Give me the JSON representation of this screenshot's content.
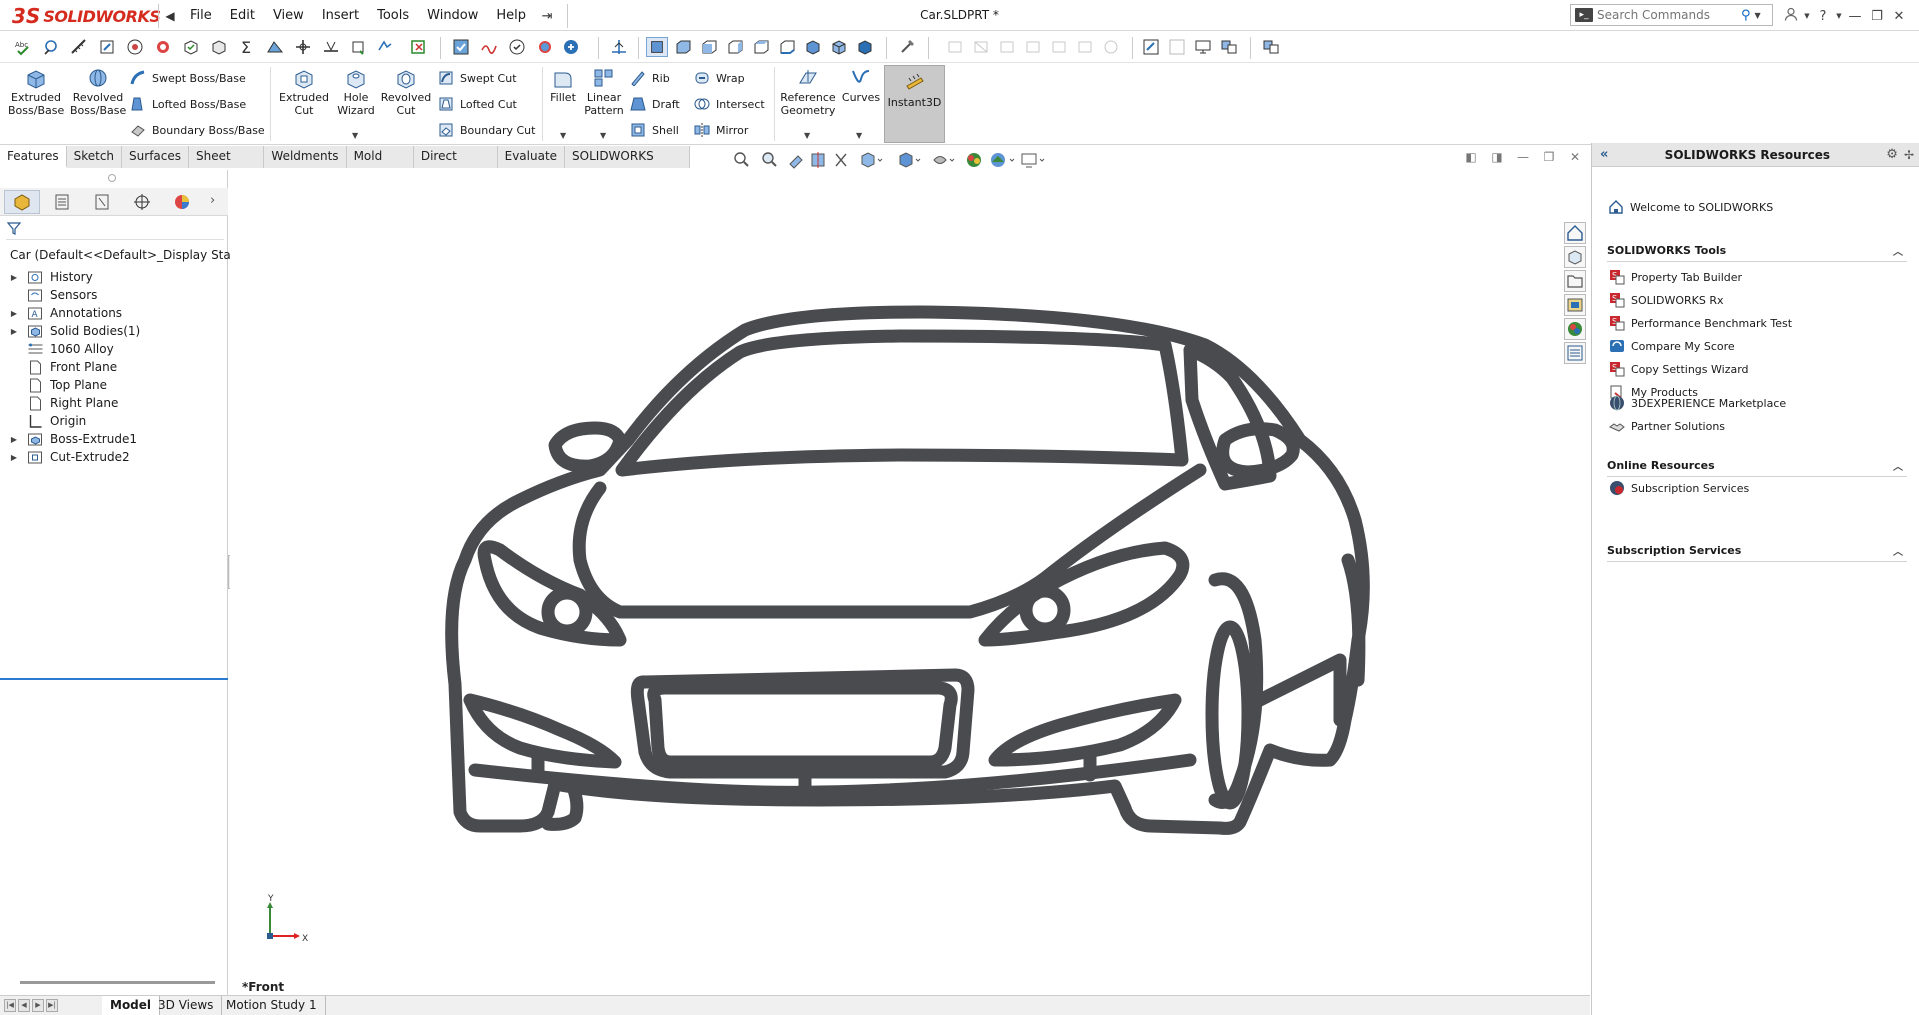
{
  "app": {
    "logo_ds": "3S",
    "logo_text": "SOLIDWORKS",
    "document_title": "Car.SLDPRT *"
  },
  "menu": [
    "File",
    "Edit",
    "View",
    "Insert",
    "Tools",
    "Window",
    "Help"
  ],
  "search": {
    "placeholder": "Search Commands"
  },
  "ribbon": {
    "extruded_boss": [
      "Extruded",
      "Boss/Base"
    ],
    "revolved_boss": [
      "Revolved",
      "Boss/Base"
    ],
    "swept_boss": "Swept Boss/Base",
    "lofted_boss": "Lofted Boss/Base",
    "boundary_boss": "Boundary Boss/Base",
    "extruded_cut": [
      "Extruded",
      "Cut"
    ],
    "hole_wizard": [
      "Hole",
      "Wizard"
    ],
    "revolved_cut": [
      "Revolved",
      "Cut"
    ],
    "swept_cut": "Swept Cut",
    "lofted_cut": "Lofted Cut",
    "boundary_cut": "Boundary Cut",
    "fillet": "Fillet",
    "linear_pattern": [
      "Linear",
      "Pattern"
    ],
    "rib": "Rib",
    "draft": "Draft",
    "shell": "Shell",
    "wrap": "Wrap",
    "intersect": "Intersect",
    "mirror": "Mirror",
    "reference_geometry": [
      "Reference",
      "Geometry"
    ],
    "curves": "Curves",
    "instant3d": "Instant3D"
  },
  "command_tabs": [
    "Features",
    "Sketch",
    "Surfaces",
    "Sheet Metal",
    "Weldments",
    "Mold Tools",
    "Direct Editing",
    "Evaluate",
    "SOLIDWORKS Add-Ins"
  ],
  "feature_tree": {
    "root": "Car  (Default<<Default>_Display State",
    "items": [
      {
        "label": "History",
        "expandable": true,
        "icon": "history-folder-icon"
      },
      {
        "label": "Sensors",
        "expandable": false,
        "icon": "sensors-icon"
      },
      {
        "label": "Annotations",
        "expandable": true,
        "icon": "annotations-icon"
      },
      {
        "label": "Solid Bodies(1)",
        "expandable": true,
        "icon": "solid-bodies-icon"
      },
      {
        "label": "1060 Alloy",
        "expandable": false,
        "icon": "material-icon"
      },
      {
        "label": "Front Plane",
        "expandable": false,
        "icon": "plane-icon"
      },
      {
        "label": "Top Plane",
        "expandable": false,
        "icon": "plane-icon"
      },
      {
        "label": "Right Plane",
        "expandable": false,
        "icon": "plane-icon"
      },
      {
        "label": "Origin",
        "expandable": false,
        "icon": "origin-icon"
      },
      {
        "label": "Boss-Extrude1",
        "expandable": true,
        "icon": "boss-extrude-icon"
      },
      {
        "label": "Cut-Extrude2",
        "expandable": true,
        "icon": "cut-extrude-icon"
      }
    ]
  },
  "graphics": {
    "view_label": "*Front",
    "axis_y": "Y",
    "axis_x": "X",
    "model_color": "#4a4b4f"
  },
  "resources": {
    "title": "SOLIDWORKS Resources",
    "welcome": "Welcome to SOLIDWORKS",
    "tools_header": "SOLIDWORKS Tools",
    "tools": [
      "Property Tab Builder",
      "SOLIDWORKS Rx",
      "Performance Benchmark Test",
      "Compare My Score",
      "Copy Settings Wizard",
      "My Products"
    ],
    "online_header": "Online Resources",
    "online": [
      "3DEXPERIENCE Marketplace",
      "Partner Solutions"
    ],
    "subscription_header": "Subscription Services",
    "subscription": [
      "Subscription Services"
    ]
  },
  "bottom_tabs": [
    "Model",
    "3D Views",
    "Motion Study 1"
  ],
  "colors": {
    "brand_red": "#d52b1e",
    "accent_blue": "#2a7bd0"
  }
}
